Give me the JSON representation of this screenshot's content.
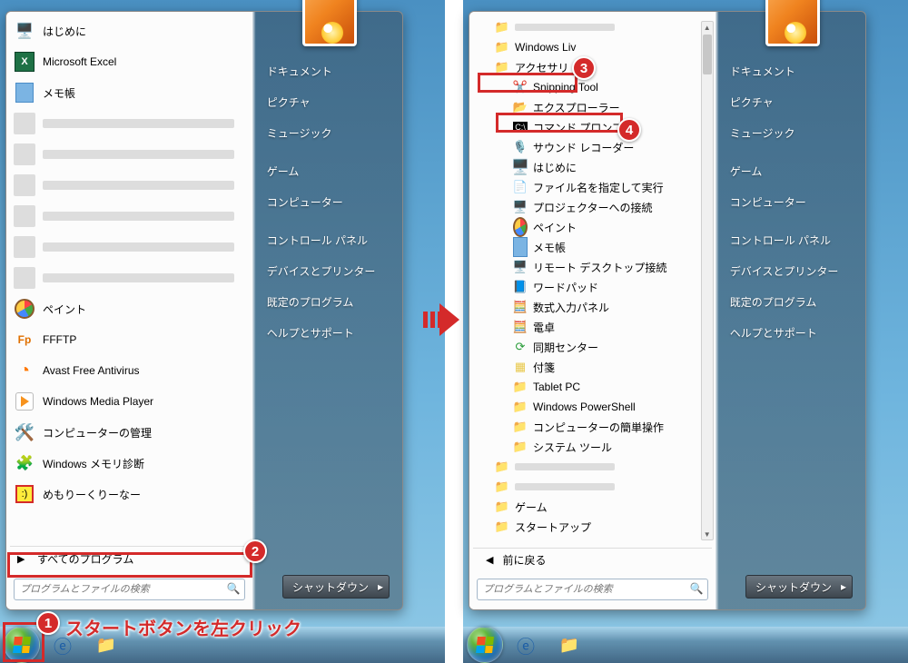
{
  "left": {
    "programs": [
      {
        "icon": "hajimeni",
        "label": "はじめに"
      },
      {
        "icon": "excel",
        "label": "Microsoft Excel"
      },
      {
        "icon": "notepad",
        "label": "メモ帳"
      },
      {
        "icon": "blank",
        "label": ""
      },
      {
        "icon": "blank",
        "label": ""
      },
      {
        "icon": "blank",
        "label": ""
      },
      {
        "icon": "blank",
        "label": ""
      },
      {
        "icon": "blank",
        "label": ""
      },
      {
        "icon": "blank",
        "label": ""
      },
      {
        "icon": "paint",
        "label": "ペイント"
      },
      {
        "icon": "ffftp",
        "label": "FFFTP"
      },
      {
        "icon": "avast",
        "label": "Avast Free Antivirus"
      },
      {
        "icon": "wmp",
        "label": "Windows Media Player"
      },
      {
        "icon": "mgmt",
        "label": "コンピューターの管理"
      },
      {
        "icon": "mem",
        "label": "Windows メモリ診断"
      },
      {
        "icon": "memcl",
        "label": "めもりーくりーなー"
      }
    ],
    "all_programs": "すべてのプログラム",
    "search_placeholder": "プログラムとファイルの検索",
    "side": [
      "ドキュメント",
      "ピクチャ",
      "ミュージック",
      "",
      "ゲーム",
      "コンピューター",
      "",
      "コントロール パネル",
      "デバイスとプリンター",
      "既定のプログラム",
      "ヘルプとサポート"
    ],
    "shutdown": "シャットダウン"
  },
  "right": {
    "tree": [
      {
        "indent": 1,
        "icon": "folder",
        "label": "",
        "blank": true
      },
      {
        "indent": 1,
        "icon": "folder",
        "label": "Windows Liv",
        "blank_after": true
      },
      {
        "indent": 1,
        "icon": "folder",
        "label": "アクセサリ",
        "hl": 3
      },
      {
        "indent": 2,
        "icon": "snip",
        "label": "Snipping Tool"
      },
      {
        "indent": 2,
        "icon": "explorer",
        "label": "エクスプローラー",
        "hl": 4
      },
      {
        "indent": 2,
        "icon": "cmd",
        "label": "コマンド プロンプト"
      },
      {
        "indent": 2,
        "icon": "rec",
        "label": "サウンド レコーダー"
      },
      {
        "indent": 2,
        "icon": "hajimeni",
        "label": "はじめに"
      },
      {
        "indent": 2,
        "icon": "run",
        "label": "ファイル名を指定して実行"
      },
      {
        "indent": 2,
        "icon": "proj",
        "label": "プロジェクターへの接続"
      },
      {
        "indent": 2,
        "icon": "paint",
        "label": "ペイント"
      },
      {
        "indent": 2,
        "icon": "notepad",
        "label": "メモ帳"
      },
      {
        "indent": 2,
        "icon": "rdp",
        "label": "リモート デスクトップ接続"
      },
      {
        "indent": 2,
        "icon": "wordpad",
        "label": "ワードパッド"
      },
      {
        "indent": 2,
        "icon": "math",
        "label": "数式入力パネル"
      },
      {
        "indent": 2,
        "icon": "calc",
        "label": "電卓"
      },
      {
        "indent": 2,
        "icon": "sync",
        "label": "同期センター"
      },
      {
        "indent": 2,
        "icon": "sticky",
        "label": "付箋"
      },
      {
        "indent": 2,
        "icon": "folder",
        "label": "Tablet PC"
      },
      {
        "indent": 2,
        "icon": "folder",
        "label": "Windows PowerShell"
      },
      {
        "indent": 2,
        "icon": "folder",
        "label": "コンピューターの簡単操作"
      },
      {
        "indent": 2,
        "icon": "folder",
        "label": "システム ツール"
      },
      {
        "indent": 1,
        "icon": "folder",
        "label": "",
        "blank": true
      },
      {
        "indent": 1,
        "icon": "folder",
        "label": "",
        "blank": true
      },
      {
        "indent": 1,
        "icon": "folder",
        "label": "ゲーム"
      },
      {
        "indent": 1,
        "icon": "folder",
        "label": "スタートアップ"
      }
    ],
    "back": "前に戻る",
    "search_placeholder": "プログラムとファイルの検索",
    "side": [
      "ドキュメント",
      "ピクチャ",
      "ミュージック",
      "",
      "ゲーム",
      "コンピューター",
      "",
      "コントロール パネル",
      "デバイスとプリンター",
      "既定のプログラム",
      "ヘルプとサポート"
    ],
    "shutdown": "シャットダウン"
  },
  "annotations": {
    "step1": "スタートボタンを左クリック"
  }
}
